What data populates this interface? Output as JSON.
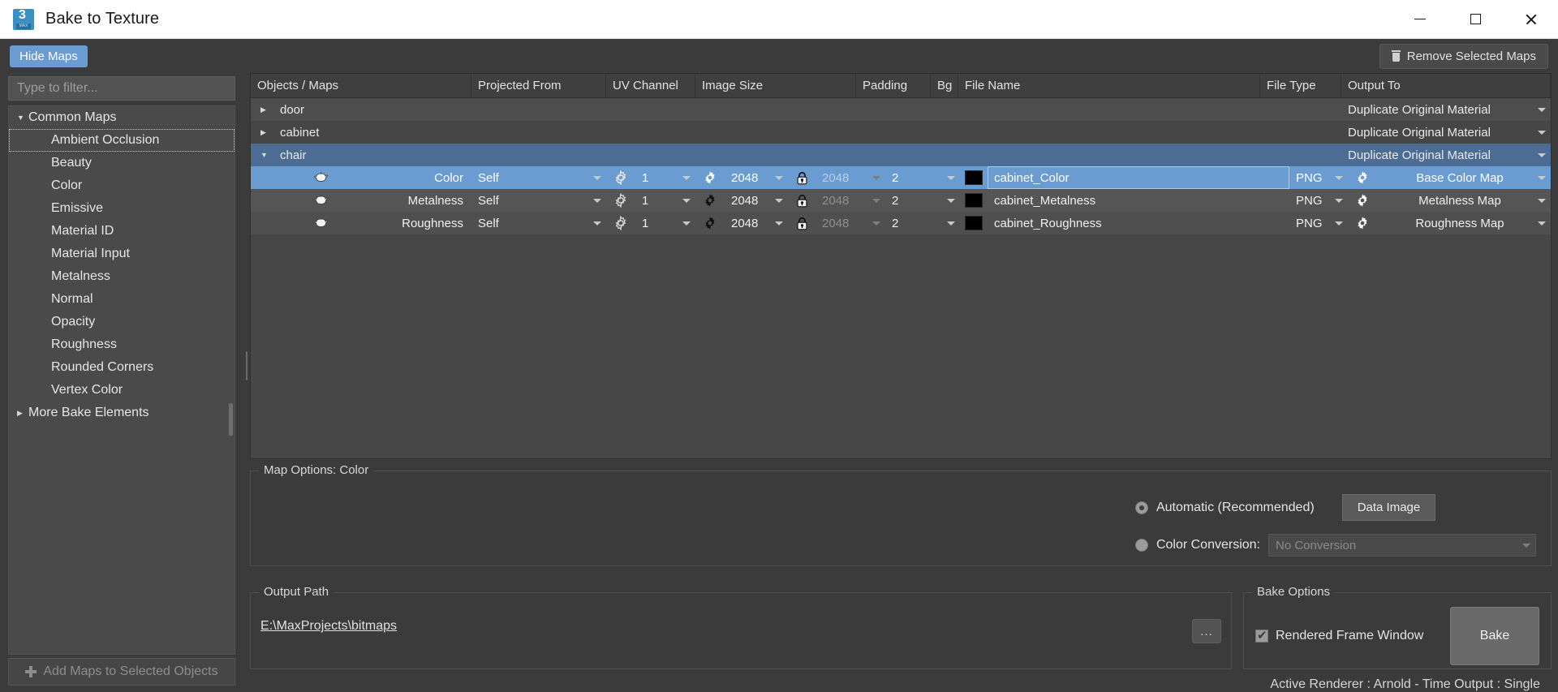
{
  "window": {
    "title": "Bake to Texture",
    "logo_number": "3",
    "logo_sub": "MAX",
    "minimize": "minimize-icon",
    "maximize": "maximize-icon",
    "close": "close-icon"
  },
  "toolbar": {
    "hide_maps_label": "Hide Maps",
    "remove_selected_maps_label": "Remove Selected Maps"
  },
  "sidebar": {
    "filter_placeholder": "Type to filter...",
    "filter_value": "",
    "groups": [
      {
        "label": "Common Maps",
        "expanded": true,
        "caret": "▼",
        "items": [
          "Ambient Occlusion",
          "Beauty",
          "Color",
          "Emissive",
          "Material ID",
          "Material Input",
          "Metalness",
          "Normal",
          "Opacity",
          "Roughness",
          "Rounded Corners",
          "Vertex Color"
        ]
      },
      {
        "label": "More Bake Elements",
        "expanded": false,
        "caret": "▶",
        "items": []
      }
    ],
    "focused_item": "Ambient Occlusion",
    "add_maps_label": "Add Maps to Selected Objects"
  },
  "table": {
    "columns": [
      "Objects / Maps",
      "Projected From",
      "UV Channel",
      "Image Size",
      "Padding",
      "Bg",
      "File Name",
      "File Type",
      "Output To"
    ],
    "objects": [
      {
        "name": "door",
        "expanded": false,
        "caret": "▶",
        "selected": false,
        "output_to": "Duplicate Original Material",
        "maps": []
      },
      {
        "name": "cabinet",
        "expanded": false,
        "caret": "▶",
        "selected": false,
        "output_to": "Duplicate Original Material",
        "maps": []
      },
      {
        "name": "chair",
        "expanded": true,
        "caret": "▼",
        "selected": true,
        "output_to": "Duplicate Original Material",
        "maps": [
          {
            "map_name": "Color",
            "projected_from": "Self",
            "uv_channel": "1",
            "image_width": "2048",
            "image_height": "2048",
            "locked": true,
            "padding": "2",
            "bg_color": "#000000",
            "file_name": "cabinet_Color",
            "file_type": "PNG",
            "output_to": "Base Color Map",
            "selected": true
          },
          {
            "map_name": "Metalness",
            "projected_from": "Self",
            "uv_channel": "1",
            "image_width": "2048",
            "image_height": "2048",
            "locked": true,
            "padding": "2",
            "bg_color": "#000000",
            "file_name": "cabinet_Metalness",
            "file_type": "PNG",
            "output_to": "Metalness Map",
            "selected": false
          },
          {
            "map_name": "Roughness",
            "projected_from": "Self",
            "uv_channel": "1",
            "image_width": "2048",
            "image_height": "2048",
            "locked": true,
            "padding": "2",
            "bg_color": "#000000",
            "file_name": "cabinet_Roughness",
            "file_type": "PNG",
            "output_to": "Roughness Map",
            "selected": false
          }
        ]
      }
    ]
  },
  "map_options": {
    "title": "Map Options: Color",
    "automatic_label": "Automatic (Recommended)",
    "automatic_selected": true,
    "color_conversion_label": "Color Conversion:",
    "color_conversion_selected": false,
    "conversion_value": "No Conversion",
    "data_image_label": "Data Image"
  },
  "output_path": {
    "title": "Output Path",
    "path": "E:\\MaxProjects\\bitmaps",
    "browse_label": "..."
  },
  "bake_options": {
    "title": "Bake Options",
    "rendered_frame_window_label": "Rendered Frame Window",
    "rendered_frame_window_checked": true,
    "bake_label": "Bake"
  },
  "status": {
    "text": "Active Renderer : Arnold  -  Time Output : Single"
  },
  "colors": {
    "accent_blue": "#6a9bd1",
    "object_selected_blue": "#4d6c94",
    "panel_bg": "#3b3b3b",
    "row_bg": "#555555"
  }
}
